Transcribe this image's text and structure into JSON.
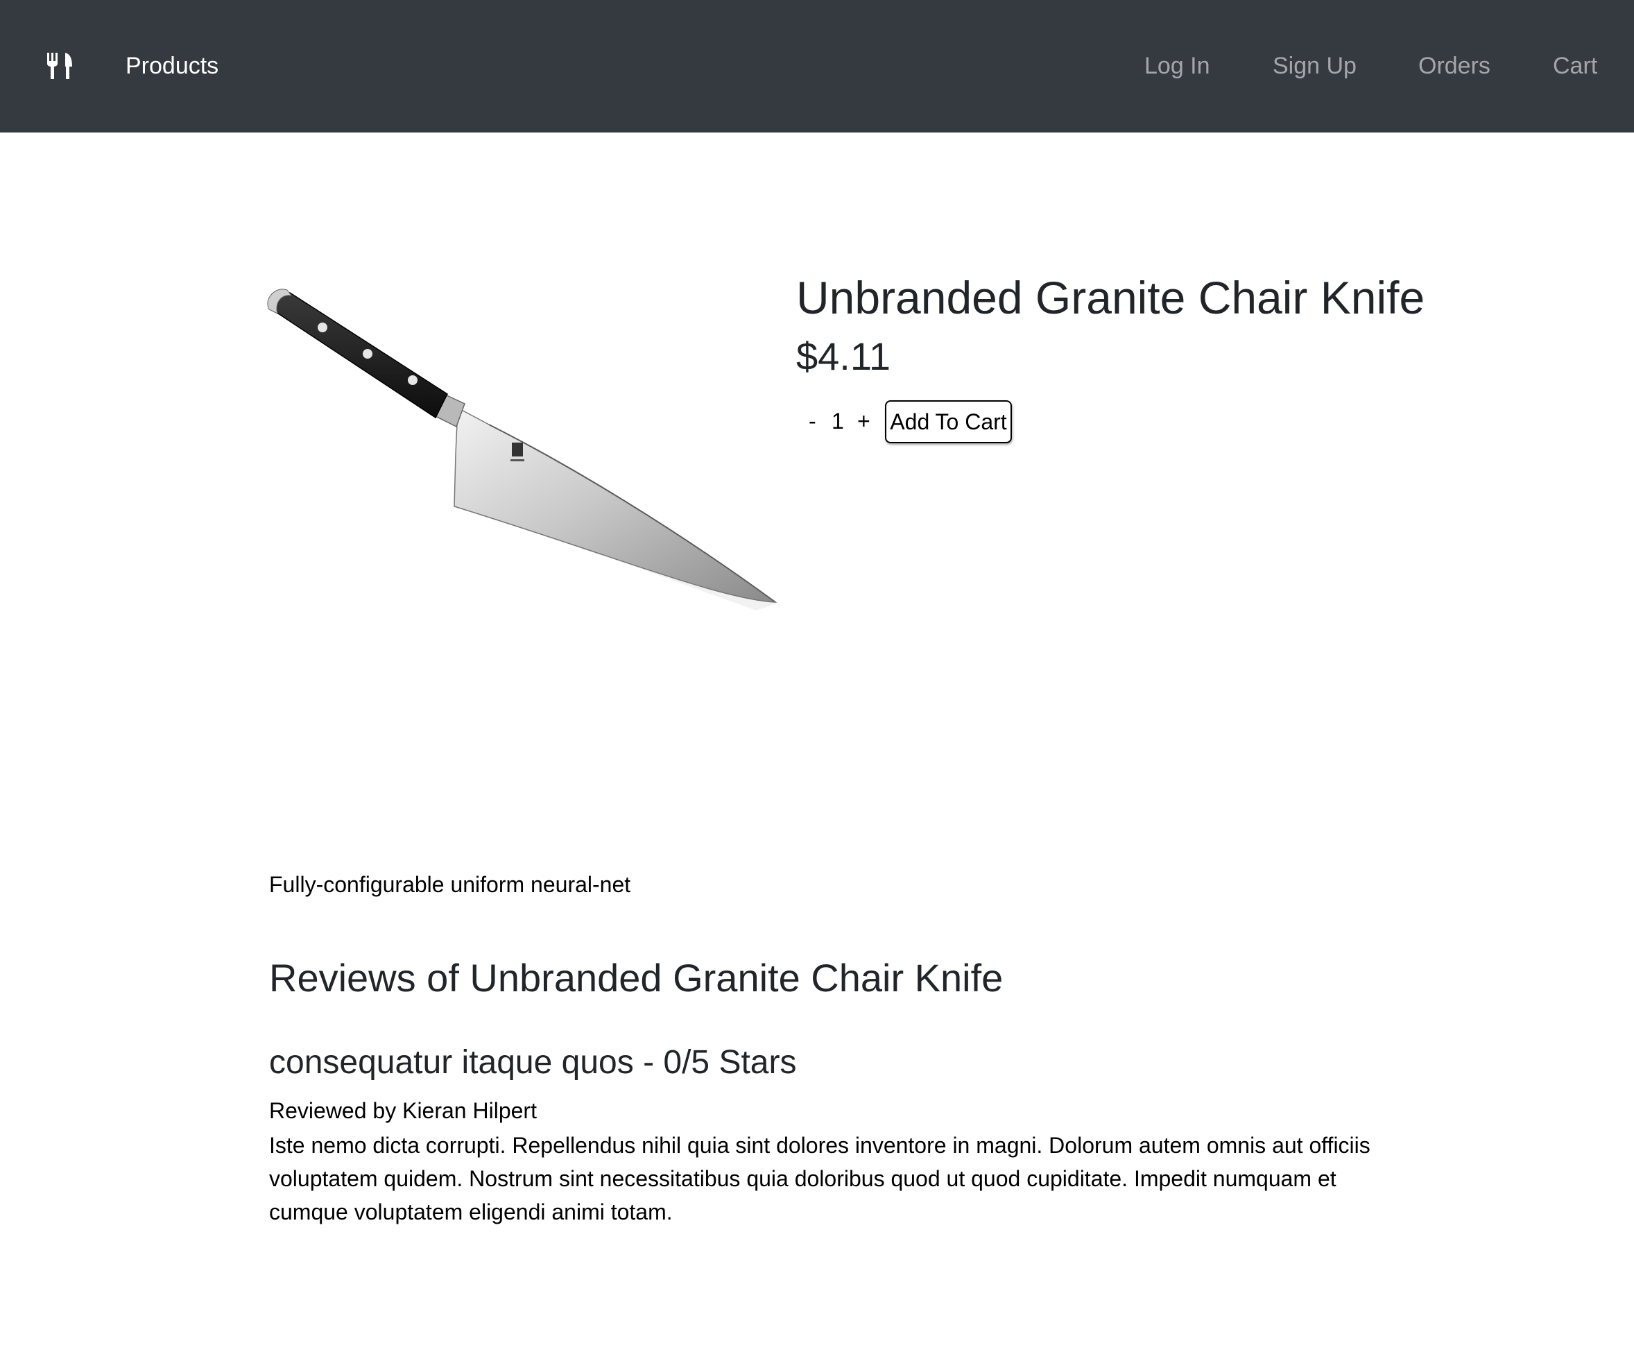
{
  "navbar": {
    "brand_icon": "fork-knife-icon",
    "products_label": "Products",
    "links": [
      "Log In",
      "Sign Up",
      "Orders",
      "Cart"
    ]
  },
  "product": {
    "image": "chef-knife-image",
    "title": "Unbranded Granite Chair Knife",
    "price": "$4.11",
    "quantity": {
      "decrement_label": "-",
      "value": "1",
      "increment_label": "+"
    },
    "add_to_cart_label": "Add To Cart",
    "description": "Fully-configurable uniform neural-net"
  },
  "reviews": {
    "heading": "Reviews of Unbranded Granite Chair Knife",
    "items": [
      {
        "title": "consequatur itaque quos - 0/5 Stars",
        "author": "Reviewed by Kieran Hilpert",
        "body": "Iste nemo dicta corrupti. Repellendus nihil quia sint dolores inventore in magni. Dolorum autem omnis aut officiis voluptatem quidem. Nostrum sint necessitatibus quia doloribus quod ut quod cupiditate. Impedit numquam et cumque voluptatem eligendi animi totam."
      }
    ]
  },
  "colors": {
    "navbar_bg": "#343a40",
    "nav_active": "#ffffff",
    "nav_inactive": "#9a9da0",
    "text": "#212529"
  }
}
